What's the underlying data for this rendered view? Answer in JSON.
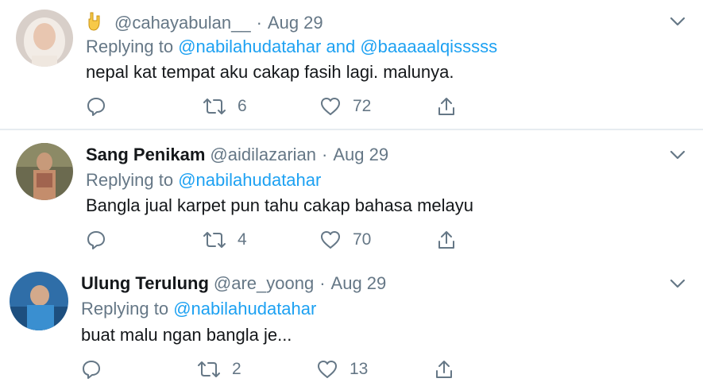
{
  "tweets": [
    {
      "display_name": "",
      "handle": "@cahayabulan__",
      "date": "Aug 29",
      "replying_prefix": "Replying to",
      "mentions": [
        "@nabilahudatahar",
        "@baaaaalqisssss"
      ],
      "mention_joiner": "and",
      "text": "nepal kat tempat aku cakap fasih lagi. malunya.",
      "retweets": "6",
      "likes": "72"
    },
    {
      "display_name": "Sang Penikam",
      "handle": "@aidilazarian",
      "date": "Aug 29",
      "replying_prefix": "Replying to",
      "mentions": [
        "@nabilahudatahar"
      ],
      "text": "Bangla jual karpet pun tahu cakap bahasa melayu",
      "retweets": "4",
      "likes": "70"
    },
    {
      "display_name": "Ulung Terulung",
      "handle": "@are_yoong",
      "date": "Aug 29",
      "replying_prefix": "Replying to",
      "mentions": [
        "@nabilahudatahar"
      ],
      "text": "buat malu ngan bangla je...",
      "retweets": "2",
      "likes": "13"
    }
  ],
  "separator": "·",
  "colors": {
    "text_primary": "#14171a",
    "text_secondary": "#657786",
    "mention": "#1da1f2",
    "divider": "#e6ecf0"
  },
  "icons": [
    "rock-on-hand-emoji",
    "chevron-down-icon",
    "reply-icon",
    "retweet-icon",
    "like-icon",
    "share-icon"
  ]
}
